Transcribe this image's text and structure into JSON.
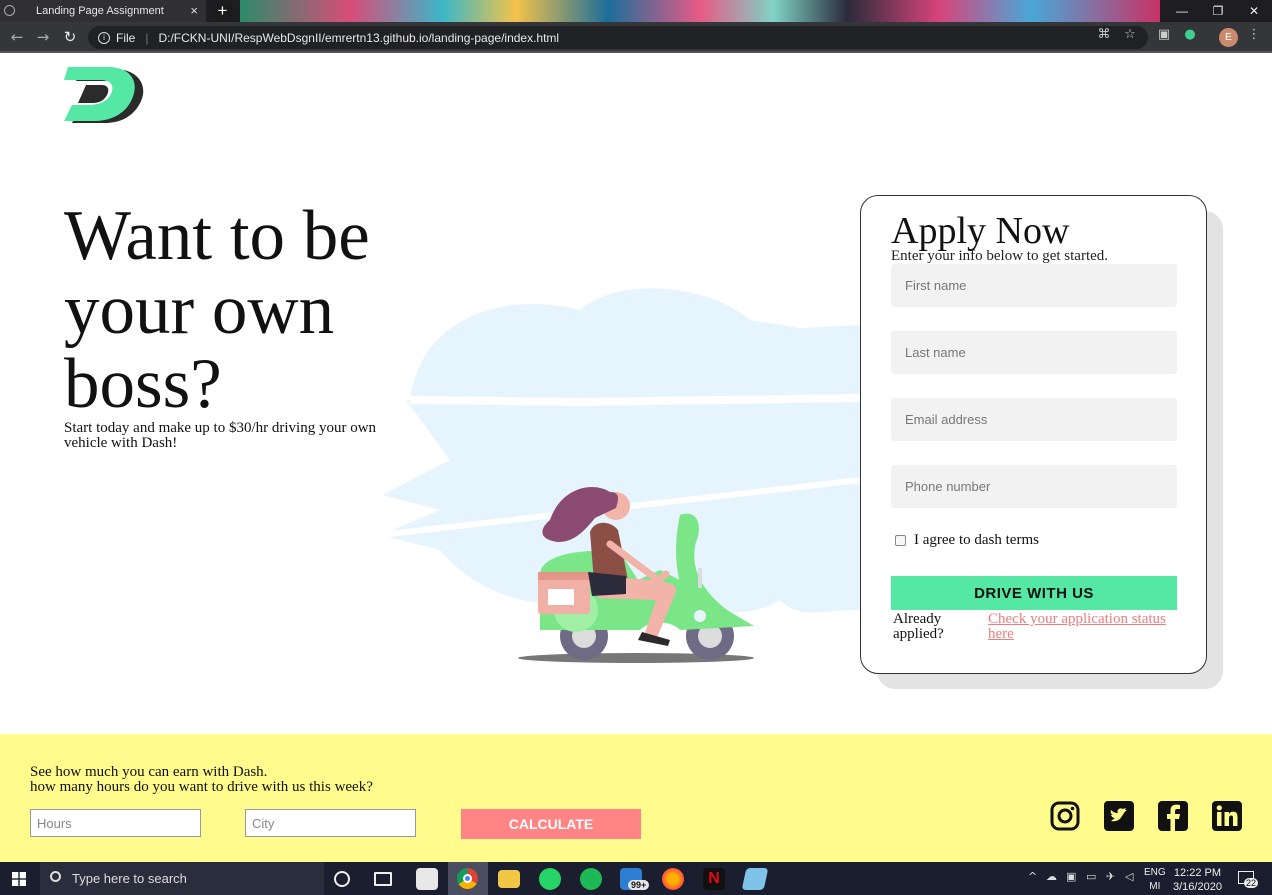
{
  "browser": {
    "tab_title": "Landing Page Assignment",
    "tab_close": "×",
    "new_tab": "+",
    "scheme_label": "File",
    "url": "D:/FCKN-UNI/RespWebDsgnII/emrertn13.github.io/landing-page/index.html",
    "profile_initial": "E",
    "window_controls": {
      "minimize": "—",
      "restore": "❐",
      "close": "✕"
    }
  },
  "hero": {
    "title": "Want to be your own boss?",
    "subtitle": "Start today and make up to $30/hr driving your own vehicle with Dash!"
  },
  "apply": {
    "title": "Apply Now",
    "subtitle": "Enter your info below to get started.",
    "first_name_placeholder": "First name",
    "last_name_placeholder": "Last name",
    "email_placeholder": "Email address",
    "phone_placeholder": "Phone number",
    "terms_label": "I agree to dash terms",
    "terms_checked": false,
    "submit_label": "DRIVE WITH US",
    "already_applied": "Already applied?",
    "status_link": "Check your application status here"
  },
  "earnings": {
    "line1": "See how much you can earn with Dash.",
    "line2": "how many hours do you want to drive with us this week?",
    "hours_placeholder": "Hours",
    "city_placeholder": "City",
    "calculate_label": "CALCULATE"
  },
  "social": [
    "instagram-icon",
    "twitter-icon",
    "facebook-icon",
    "linkedin-icon"
  ],
  "taskbar": {
    "search_placeholder": "Type here to search",
    "mail_badge": "99+",
    "lang_line1": "ENG",
    "lang_line2": "MI",
    "time": "12:22 PM",
    "date": "3/16/2020",
    "notifications": "22"
  },
  "colors": {
    "brand_green": "#54e8a4",
    "cta_red": "#ff8585",
    "band_yellow": "#fffb8c",
    "link_red": "#f07c7c"
  }
}
